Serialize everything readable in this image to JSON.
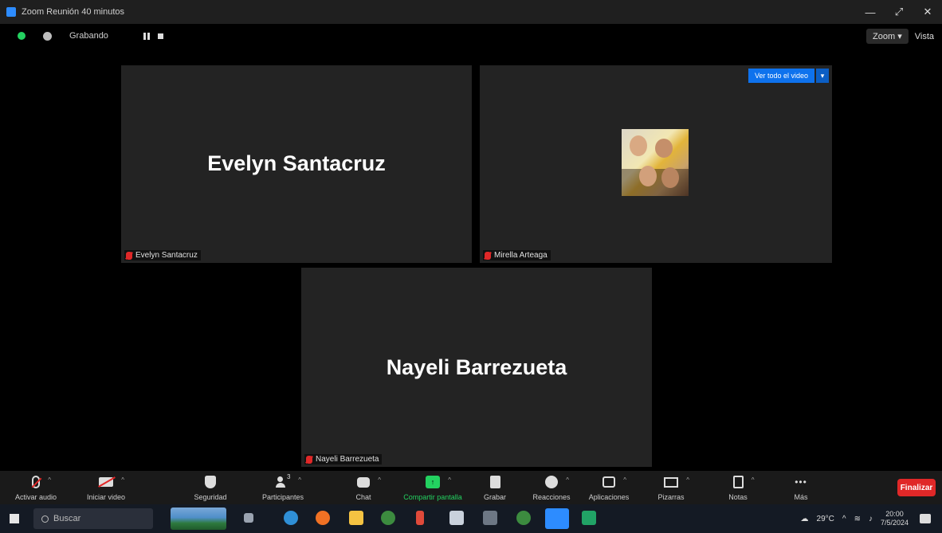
{
  "window": {
    "title": "Zoom Reunión 40 minutos",
    "controls": [
      "—",
      "⤢",
      "✕"
    ]
  },
  "topbar": {
    "recording_label": "Grabando",
    "view_label": "Zoom",
    "view_button": "Vista"
  },
  "participants": [
    {
      "big_name": "Evelyn Santacruz",
      "tag": "Evelyn Santacruz"
    },
    {
      "big_name": "",
      "tag": "Mirella Arteaga",
      "pin_button": "Ver todo el video"
    },
    {
      "big_name": "Nayeli Barrezueta",
      "tag": "Nayeli Barrezueta"
    }
  ],
  "toolbar": {
    "items": [
      {
        "label": "Activar audio",
        "icon": "mic-muted-icon"
      },
      {
        "label": "Iniciar video",
        "icon": "video-off-icon"
      },
      {
        "label": "Seguridad",
        "icon": "shield-icon"
      },
      {
        "label": "Participantes",
        "icon": "participants-icon",
        "count": "3"
      },
      {
        "label": "Chat",
        "icon": "chat-icon"
      },
      {
        "label": "Compartir pantalla",
        "icon": "share-screen-icon"
      },
      {
        "label": "Grabar",
        "icon": "record-icon"
      },
      {
        "label": "Reacciones",
        "icon": "reactions-icon"
      },
      {
        "label": "Aplicaciones",
        "icon": "apps-icon"
      },
      {
        "label": "Pizarras",
        "icon": "whiteboard-icon"
      },
      {
        "label": "Notas",
        "icon": "notes-icon"
      },
      {
        "label": "Más",
        "icon": "more-icon"
      }
    ],
    "end_button": "Finalizar"
  },
  "taskbar": {
    "search_placeholder": "Buscar",
    "temperature": "29°C",
    "time": "20:00",
    "date": "7/5/2024"
  }
}
